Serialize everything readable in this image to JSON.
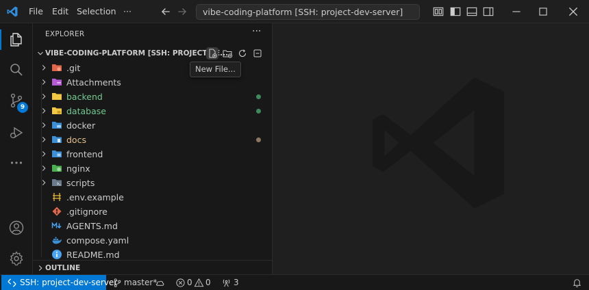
{
  "titlebar": {
    "menu": [
      {
        "label": "File"
      },
      {
        "label": "Edit"
      },
      {
        "label": "Selection"
      }
    ],
    "more": "···",
    "command_center": "vibe-coding-platform [SSH: project-dev-server]"
  },
  "activitybar": {
    "source_control_badge": "9"
  },
  "sidebar": {
    "title": "EXPLORER",
    "more": "···",
    "folder_title": "VIBE-CODING-PLATFORM [SSH: PROJECT-DE...",
    "tooltip": "New File...",
    "outline_title": "OUTLINE",
    "items": [
      {
        "name": ".git",
        "type": "folder",
        "icon": "git-folder-icon",
        "color": "#cccccc"
      },
      {
        "name": "Attachments",
        "type": "folder",
        "icon": "attachments-folder-icon",
        "color": "#cccccc"
      },
      {
        "name": "backend",
        "type": "folder",
        "icon": "backend-folder-icon",
        "color": "#73c991",
        "decoration": "#3f8a5c"
      },
      {
        "name": "database",
        "type": "folder",
        "icon": "database-folder-icon",
        "color": "#73c991",
        "decoration": "#3f8a5c"
      },
      {
        "name": "docker",
        "type": "folder",
        "icon": "docker-folder-icon",
        "color": "#cccccc"
      },
      {
        "name": "docs",
        "type": "folder",
        "icon": "docs-folder-icon",
        "color": "#e2c08d",
        "decoration": "#8c7660"
      },
      {
        "name": "frontend",
        "type": "folder",
        "icon": "frontend-folder-icon",
        "color": "#cccccc"
      },
      {
        "name": "nginx",
        "type": "folder",
        "icon": "nginx-folder-icon",
        "color": "#cccccc"
      },
      {
        "name": "scripts",
        "type": "folder",
        "icon": "scripts-folder-icon",
        "color": "#cccccc"
      },
      {
        "name": ".env.example",
        "type": "file",
        "icon": "env-file-icon",
        "color": "#cccccc"
      },
      {
        "name": ".gitignore",
        "type": "file",
        "icon": "gitignore-file-icon",
        "color": "#cccccc"
      },
      {
        "name": "AGENTS.md",
        "type": "file",
        "icon": "markdown-file-icon",
        "color": "#cccccc"
      },
      {
        "name": "compose.yaml",
        "type": "file",
        "icon": "docker-compose-file-icon",
        "color": "#cccccc"
      },
      {
        "name": "README.md",
        "type": "file",
        "icon": "readme-file-icon",
        "color": "#cccccc"
      }
    ]
  },
  "statusbar": {
    "remote": "SSH: project-dev-server",
    "branch": "master*",
    "errors": "0",
    "warnings": "0",
    "ports": "3"
  },
  "colors": {
    "accent": "#0078d4",
    "background": "#1f1f1f",
    "sidebar_bg": "#181818",
    "added_green": "#73c991",
    "modified_yellow": "#e2c08d"
  }
}
